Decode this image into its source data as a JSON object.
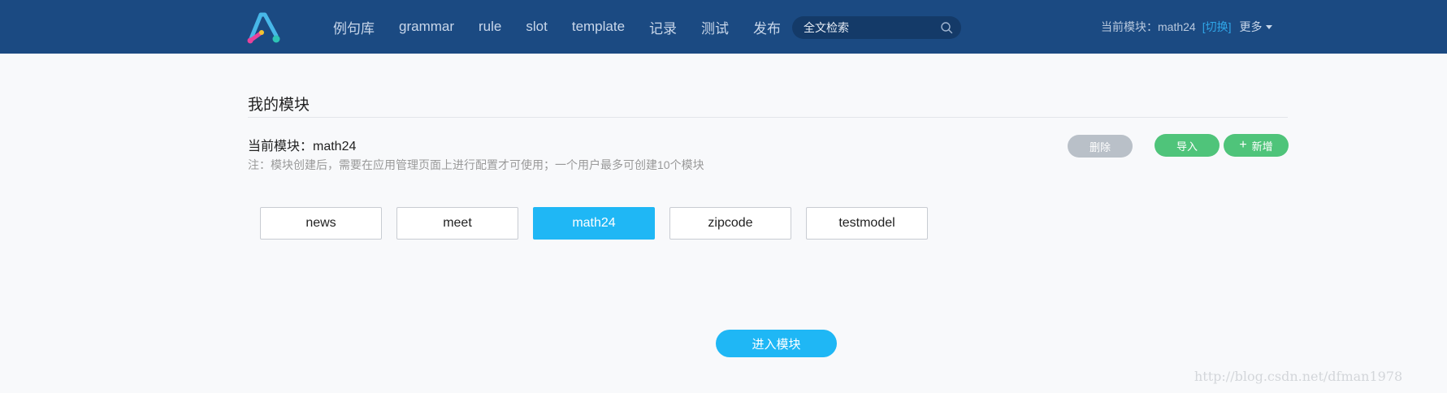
{
  "nav": {
    "items": [
      "例句库",
      "grammar",
      "rule",
      "slot",
      "template",
      "记录",
      "测试",
      "发布"
    ]
  },
  "search": {
    "placeholder": "全文检索",
    "icon": "search-icon"
  },
  "header_module": {
    "label": "当前模块：math24",
    "switch_label": "[切换]",
    "more_label": "更多"
  },
  "page": {
    "title": "我的模块",
    "current_module": "当前模块：math24",
    "note": "注：模块创建后，需要在应用管理页面上进行配置才可使用；一个用户最多可创建10个模块"
  },
  "actions": {
    "delete_label": "删除",
    "import_label": "导入",
    "add_label": "新增",
    "add_icon": "plus-icon"
  },
  "modules": [
    {
      "name": "news",
      "selected": false
    },
    {
      "name": "meet",
      "selected": false
    },
    {
      "name": "math24",
      "selected": true
    },
    {
      "name": "zipcode",
      "selected": false
    },
    {
      "name": "testmodel",
      "selected": false
    }
  ],
  "enter_button": {
    "label": "进入模块"
  },
  "watermark": "http://blog.csdn.net/dfman1978",
  "colors": {
    "header_bg": "#1b4a82",
    "accent": "#1fb7f5",
    "green": "#4fc47a",
    "link": "#2fa6e8"
  }
}
